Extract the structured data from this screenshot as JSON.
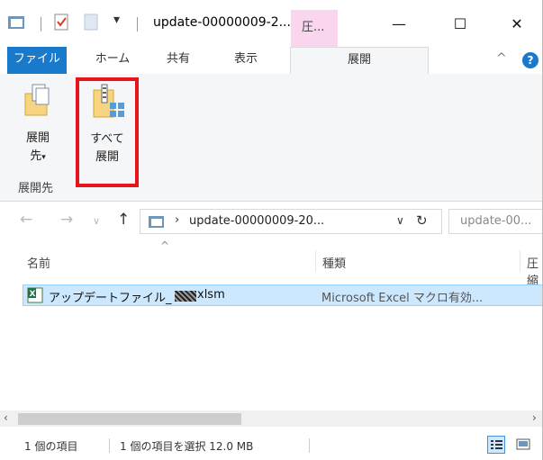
{
  "window": {
    "title": "update-00000009-2...",
    "contextual_tab": "圧...",
    "minimize": "—",
    "maximize": "☐",
    "close": "✕"
  },
  "ribbon_tabs": {
    "file": "ファイル",
    "home": "ホーム",
    "share": "共有",
    "view": "表示",
    "extract": "展開",
    "collapse_glyph": "^",
    "help_glyph": "?"
  },
  "ribbon": {
    "extract_to_line1": "展開",
    "extract_to_line2": "先",
    "extract_all_line1": "すべて",
    "extract_all_line2": "展開",
    "group_label": "展開先"
  },
  "addressbar": {
    "path": "update-00000009-20...",
    "search_placeholder": "update-00..."
  },
  "columns": {
    "name": "名前",
    "type": "種類",
    "compressed": "圧縮"
  },
  "files": [
    {
      "name_prefix": "アップデートファイル_",
      "name_suffix": "xlsm",
      "type": "Microsoft Excel マクロ有効..."
    }
  ],
  "status": {
    "item_count": "1 個の項目",
    "selected": "1 個の項目を選択  12.0 MB"
  },
  "colors": {
    "accent": "#1979ca",
    "contextual": "#f9d5ee",
    "highlight": "#e8141b",
    "selection": "#cce8ff"
  }
}
